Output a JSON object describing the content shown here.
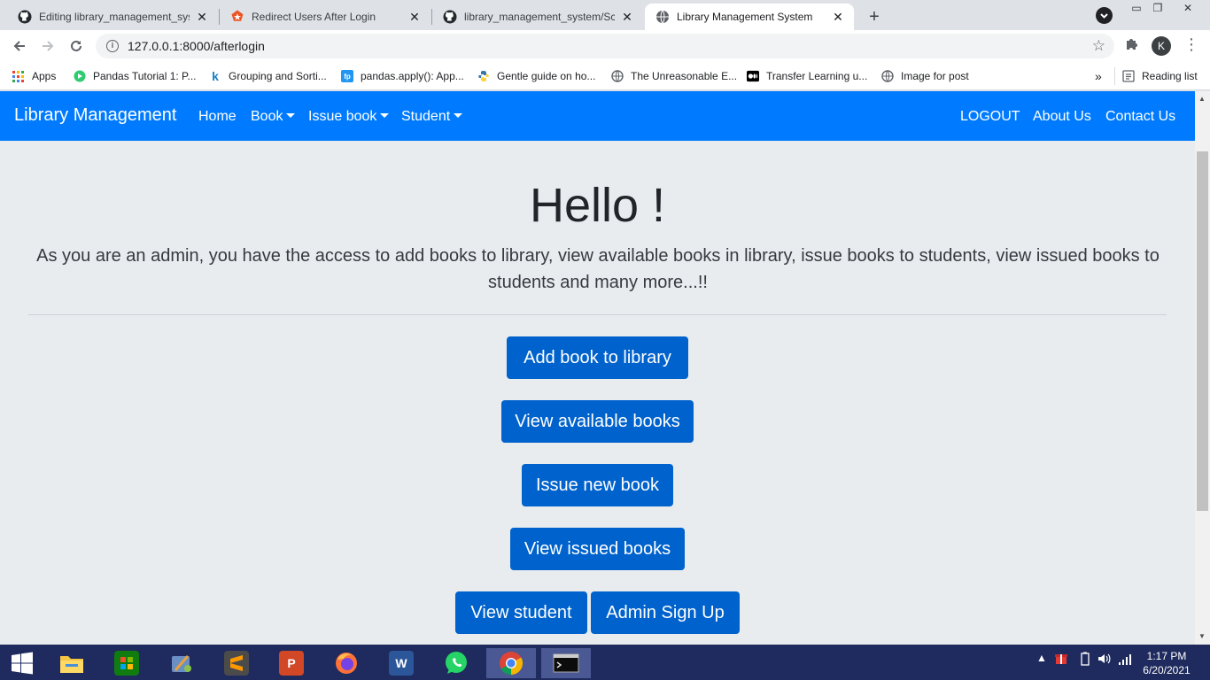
{
  "browser": {
    "tabs": [
      {
        "title": "Editing library_management_syst",
        "icon": "github-icon",
        "active": false
      },
      {
        "title": "Redirect Users After Login",
        "icon": "auth0-icon",
        "active": false
      },
      {
        "title": "library_management_system/Scre",
        "icon": "github-icon",
        "active": false
      },
      {
        "title": "Library Management System",
        "icon": "globe-icon",
        "active": true
      }
    ],
    "new_tab": "+",
    "url": "127.0.0.1:8000/afterlogin",
    "avatar_letter": "K",
    "bookmarks": [
      {
        "label": "Apps",
        "icon": "apps-grid-icon"
      },
      {
        "label": "Pandas Tutorial 1: P...",
        "icon": "pandas-icon"
      },
      {
        "label": "Grouping and Sorti...",
        "icon": "k-icon"
      },
      {
        "label": "pandas.apply(): App...",
        "icon": "fp-icon"
      },
      {
        "label": "Gentle guide on ho...",
        "icon": "python-icon"
      },
      {
        "label": "The Unreasonable E...",
        "icon": "globe-icon"
      },
      {
        "label": "Transfer Learning u...",
        "icon": "medium-icon"
      },
      {
        "label": "Image for post",
        "icon": "globe-icon"
      }
    ],
    "more_bookmarks": "»",
    "reading_list": "Reading list"
  },
  "navbar": {
    "brand": "Library Management",
    "links": [
      {
        "label": "Home",
        "dropdown": false
      },
      {
        "label": "Book",
        "dropdown": true
      },
      {
        "label": "Issue book",
        "dropdown": true
      },
      {
        "label": "Student",
        "dropdown": true
      }
    ],
    "right_links": [
      "LOGOUT",
      "About Us",
      "Contact Us"
    ]
  },
  "hero": {
    "heading": "Hello !",
    "lead": "As you are an admin, you have the access to add books to library, view available books in library, issue books to students, view issued books to students and many more...!!"
  },
  "actions": {
    "add_book": "Add book to library",
    "view_available": "View available books",
    "issue_new": "Issue new book",
    "view_issued": "View issued books",
    "view_student": "View student",
    "admin_signup": "Admin Sign Up"
  },
  "taskbar": {
    "apps": [
      "windows-start-icon",
      "file-explorer-icon",
      "store-icon",
      "setup-icon",
      "sublime-text-icon",
      "powerpoint-icon",
      "firefox-icon",
      "word-icon",
      "whatsapp-icon",
      "chrome-icon",
      "terminal-icon"
    ],
    "time": "1:17 PM",
    "date": "6/20/2021"
  },
  "colors": {
    "navbar": "#007bff",
    "button": "#0062cc",
    "page_bg": "#e9ecef",
    "taskbar": "#1f2b5e"
  }
}
